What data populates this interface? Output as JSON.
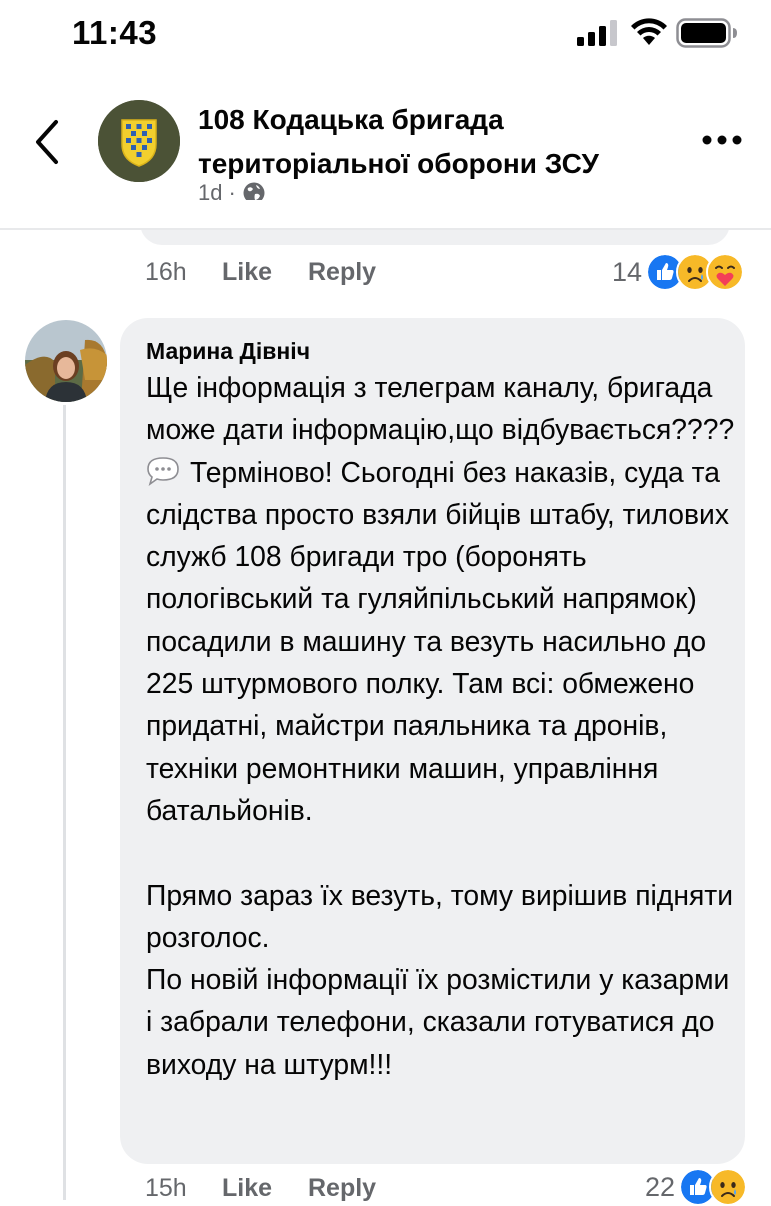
{
  "status_bar": {
    "time": "11:43"
  },
  "header": {
    "page_name": "108 Кодацька бригада територіальної оборони ЗСУ",
    "post_age": "1d",
    "separator": "·"
  },
  "previous_comment": {
    "time": "16h",
    "like_label": "Like",
    "reply_label": "Reply",
    "reaction_count": "14",
    "reactions": [
      "like-icon",
      "sad-icon",
      "care-icon"
    ]
  },
  "comment": {
    "author": "Марина Дівніч",
    "line1": "Ще інформація з телеграм каналу, бригада може дати інформацію,що відбувається????",
    "line2": "Терміново! Сьогодні без наказів, суда та слідства просто взяли бійців штабу, тилових служб 108 бригади тро (боронять пологівський та гуляйпільський напрямок) посадили в машину та везуть насильно до 225 штурмового полку. Там всі: обмежено придатні, майстри паяльника та дронів, техніки ремонтники машин, управління батальйонів.",
    "line3": "Прямо зараз їх везуть, тому вирішив підняти розголос.",
    "line4": "По новій інформації їх розмістили у казарми і забрали телефони, сказали готуватися до виходу на штурм!!!",
    "time": "15h",
    "like_label": "Like",
    "reply_label": "Reply",
    "reaction_count": "22",
    "reactions": [
      "like-icon",
      "sad-icon"
    ]
  },
  "colors": {
    "secondary_text": "#65676b",
    "bubble": "#eff0f2",
    "like_blue": "#1877f2"
  }
}
